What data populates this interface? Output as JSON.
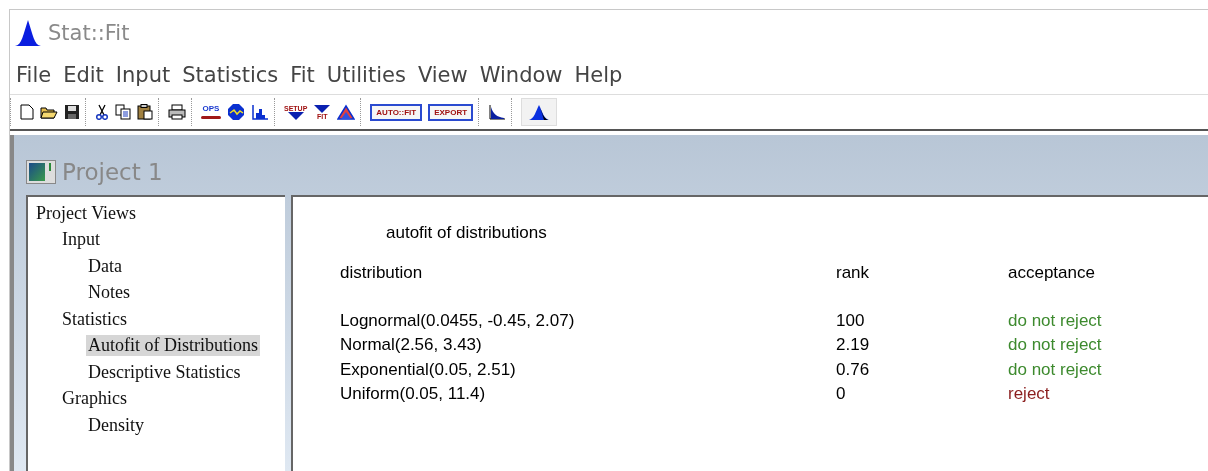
{
  "window": {
    "title": "Stat::Fit"
  },
  "menu": [
    "File",
    "Edit",
    "Input",
    "Statistics",
    "Fit",
    "Utilities",
    "View",
    "Window",
    "Help"
  ],
  "toolbar": [
    [
      {
        "kind": "new"
      },
      {
        "kind": "open"
      },
      {
        "kind": "save"
      }
    ],
    [
      {
        "kind": "cut"
      },
      {
        "kind": "copy"
      },
      {
        "kind": "paste"
      }
    ],
    [
      {
        "kind": "print"
      }
    ],
    [
      {
        "kind": "ops",
        "label": "OPS"
      },
      {
        "kind": "scan"
      },
      {
        "kind": "histogram"
      }
    ],
    [
      {
        "kind": "setup",
        "label": "SETUP"
      },
      {
        "kind": "fit",
        "label": "FIT"
      },
      {
        "kind": "compare"
      }
    ],
    [
      {
        "kind": "textbutton",
        "label": "AUTO::FIT"
      },
      {
        "kind": "textbutton",
        "label": "EXPORT"
      }
    ],
    [
      {
        "kind": "decay"
      }
    ],
    [
      {
        "kind": "peak"
      }
    ]
  ],
  "project": {
    "title": "Project 1",
    "tree": [
      {
        "label": "Project Views",
        "selected": false,
        "children": [
          {
            "label": "Input",
            "selected": false,
            "children": [
              {
                "label": "Data",
                "selected": false
              },
              {
                "label": "Notes",
                "selected": false
              }
            ]
          },
          {
            "label": "Statistics",
            "selected": false,
            "children": [
              {
                "label": "Autofit of Distributions",
                "selected": true
              },
              {
                "label": "Descriptive Statistics",
                "selected": false
              }
            ]
          },
          {
            "label": "Graphics",
            "selected": false,
            "children": [
              {
                "label": "Density",
                "selected": false
              }
            ]
          }
        ]
      }
    ]
  },
  "report": {
    "title": "autofit of distributions",
    "columns": [
      "distribution",
      "rank",
      "acceptance"
    ],
    "rows": [
      {
        "distribution": "Lognormal(0.0455, -0.45, 2.07)",
        "rank": "100",
        "acceptance": "do not reject",
        "color": "#3d8a2e"
      },
      {
        "distribution": "Normal(2.56, 3.43)",
        "rank": "2.19",
        "acceptance": "do not reject",
        "color": "#3d8a2e"
      },
      {
        "distribution": "Exponential(0.05, 2.51)",
        "rank": "0.76",
        "acceptance": "do not reject",
        "color": "#3d8a2e"
      },
      {
        "distribution": "Uniform(0.05, 11.4)",
        "rank": "0",
        "acceptance": "reject",
        "color": "#8b1e1e"
      }
    ]
  }
}
